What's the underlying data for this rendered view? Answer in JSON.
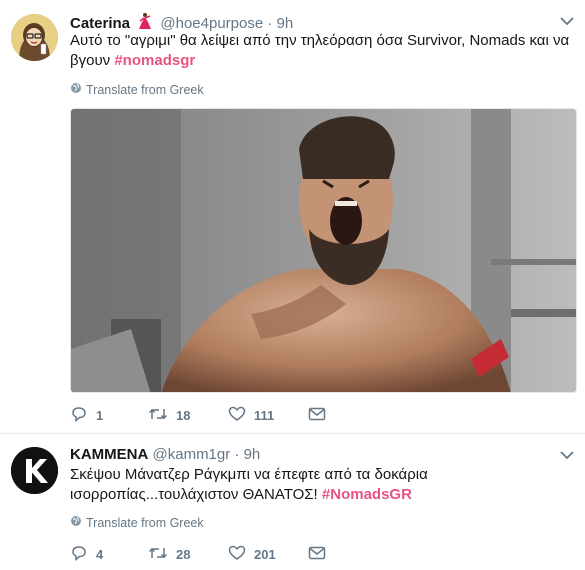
{
  "tweets": [
    {
      "name": "Caterina",
      "handle": "@hoe4purpose",
      "dot": "·",
      "time": "9h",
      "text": "Αυτό το \"αγριμι\" θα λείψει από την τηλεόραση όσα Survivor, Nomads και να βγουν ",
      "hashtag": "#nomadsgr",
      "translate": "Translate from Greek",
      "replies": "1",
      "retweets": "18",
      "likes": "111"
    },
    {
      "name": "KAMMENA",
      "handle": "@kamm1gr",
      "dot": "·",
      "time": "9h",
      "text": "Σκέψου Μάνατζερ Ράγκμπι να έπεφτε από τα δοκάρια ισορροπίας...τουλάχιστον ΘΑΝΑΤΟΣ! ",
      "hashtag": "#NomadsGR",
      "translate": "Translate from Greek",
      "replies": "4",
      "retweets": "28",
      "likes": "201"
    }
  ],
  "colors": {
    "hashtag": "#e75480",
    "muted": "#657786",
    "divider": "#e6ecf0"
  }
}
